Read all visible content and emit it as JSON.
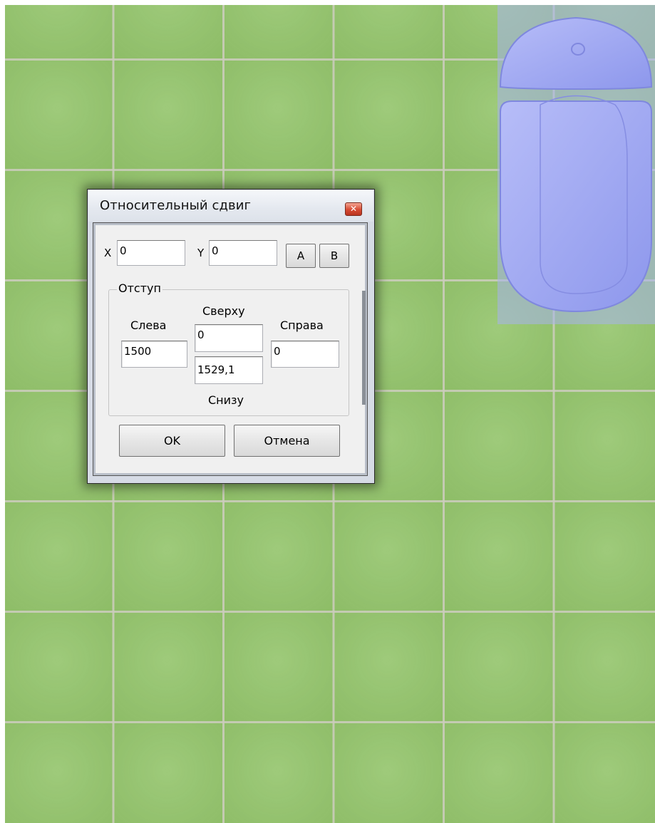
{
  "dialog": {
    "title": "Относительный сдвиг",
    "close_icon": "close-icon",
    "x_label": "X",
    "x_value": "0",
    "y_label": "Y",
    "y_value": "0",
    "button_a": "A",
    "button_b": "B",
    "group_title": "Отступ",
    "left_label": "Слева",
    "left_value": "1500",
    "top_label": "Сверху",
    "top_value": "0",
    "bottom_value": "1529,1",
    "bottom_label": "Снизу",
    "right_label": "Справа",
    "right_value": "0",
    "ok_label": "OK",
    "cancel_label": "Отмена"
  },
  "colors": {
    "tile": "#93c46b",
    "grout": "#cdcdbe",
    "fixture": "#9fa8f2",
    "close_button": "#d64a32"
  }
}
